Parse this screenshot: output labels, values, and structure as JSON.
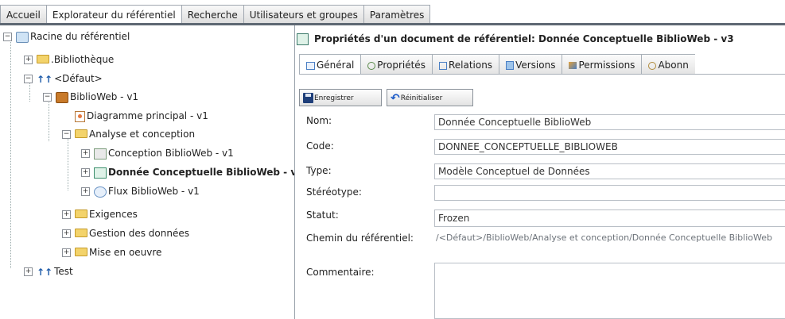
{
  "top_tabs": [
    {
      "label": "Accueil"
    },
    {
      "label": "Explorateur du référentiel"
    },
    {
      "label": "Recherche"
    },
    {
      "label": "Utilisateurs et groupes"
    },
    {
      "label": "Paramètres"
    }
  ],
  "tree": {
    "items": [
      {
        "label": "Racine du référentiel"
      },
      {
        "label": ".Bibliothèque"
      },
      {
        "label": "<Défaut>"
      },
      {
        "label": "BiblioWeb - v1"
      },
      {
        "label": "Diagramme principal - v1"
      },
      {
        "label": "Analyse et conception"
      },
      {
        "label": "Conception BiblioWeb - v1"
      },
      {
        "label": "Donnée Conceptuelle BiblioWeb - v"
      },
      {
        "label": "Flux BiblioWeb - v1"
      },
      {
        "label": "Exigences"
      },
      {
        "label": "Gestion des données"
      },
      {
        "label": "Mise en oeuvre"
      },
      {
        "label": "Test"
      }
    ]
  },
  "panel": {
    "title": "Propriétés d'un document de référentiel:  Donnée Conceptuelle BiblioWeb - v3",
    "tabs": [
      {
        "label": "Général"
      },
      {
        "label": "Propriétés"
      },
      {
        "label": "Relations"
      },
      {
        "label": "Versions"
      },
      {
        "label": "Permissions"
      },
      {
        "label": "Abonn"
      }
    ],
    "save_label": "Enregistrer",
    "reset_label": "Réinitialiser",
    "fields": {
      "nom": {
        "label": "Nom:",
        "value": "Donnée Conceptuelle BiblioWeb"
      },
      "code": {
        "label": "Code:",
        "value": "DONNEE_CONCEPTUELLE_BIBLIOWEB"
      },
      "type": {
        "label": "Type:",
        "value": "Modèle Conceptuel de Données"
      },
      "stereotype": {
        "label": "Stéréotype:",
        "value": ""
      },
      "statut": {
        "label": "Statut:",
        "value": "Frozen"
      },
      "chemin": {
        "label": "Chemin du référentiel:",
        "value": "/<Défaut>/BiblioWeb/Analyse et conception/Donnée Conceptuelle BiblioWeb"
      },
      "commentaire": {
        "label": "Commentaire:",
        "value": ""
      }
    }
  }
}
